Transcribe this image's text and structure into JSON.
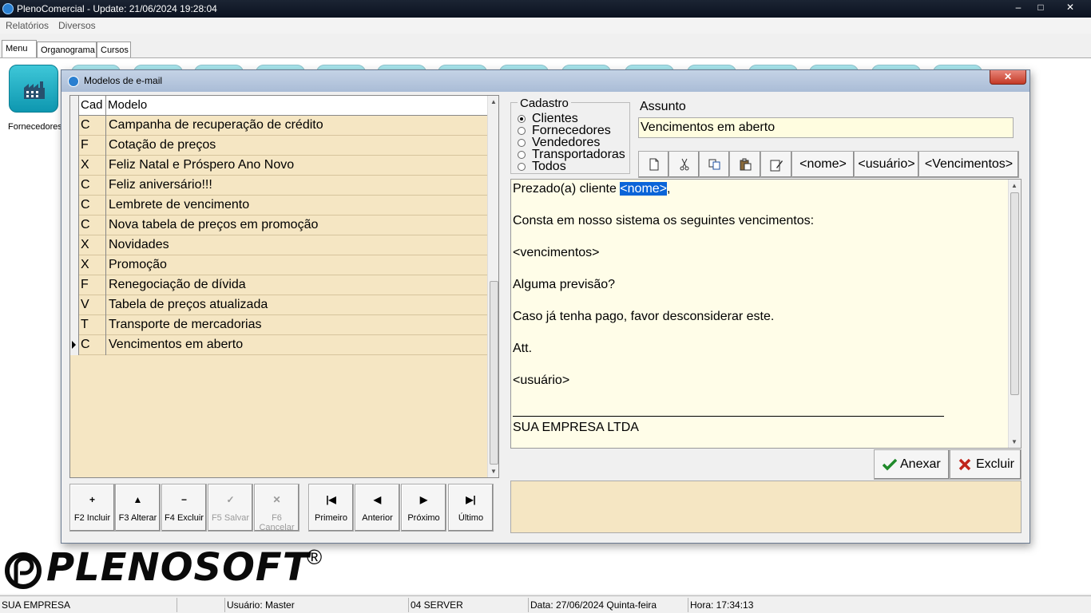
{
  "window": {
    "title": "PlenoComercial - Update: 21/06/2024 19:28:04",
    "minimize_icon": "minimize-icon",
    "maximize_icon": "maximize-icon",
    "close_icon": "close-icon"
  },
  "menu": {
    "items": [
      {
        "label": "Relatórios"
      },
      {
        "label": "Diversos"
      }
    ]
  },
  "tabs": [
    {
      "label": "Menu"
    },
    {
      "label": "Organograma"
    },
    {
      "label": "Cursos"
    }
  ],
  "desktop": {
    "fornecedores_label": "Fornecedores"
  },
  "dialog": {
    "title": "Modelos de e-mail",
    "close_label": "✕",
    "grid": {
      "col_cad": "Cad",
      "col_modelo": "Modelo",
      "rows": [
        {
          "cad": "C",
          "modelo": "Campanha de recuperação de crédito"
        },
        {
          "cad": "F",
          "modelo": "Cotação de preços"
        },
        {
          "cad": "X",
          "modelo": "Feliz Natal e Próspero Ano Novo"
        },
        {
          "cad": "C",
          "modelo": "Feliz aniversário!!!"
        },
        {
          "cad": "C",
          "modelo": "Lembrete de vencimento"
        },
        {
          "cad": "C",
          "modelo": "Nova tabela de preços em promoção"
        },
        {
          "cad": "X",
          "modelo": "Novidades"
        },
        {
          "cad": "X",
          "modelo": "Promoção"
        },
        {
          "cad": "F",
          "modelo": "Renegociação de dívida"
        },
        {
          "cad": "V",
          "modelo": "Tabela de preços atualizada"
        },
        {
          "cad": "T",
          "modelo": "Transporte de mercadorias"
        },
        {
          "cad": "C",
          "modelo": "Vencimentos em aberto"
        }
      ],
      "current_row": 11
    },
    "nav_buttons": [
      {
        "glyph": "+",
        "label": "F2 Incluir",
        "enabled": true
      },
      {
        "glyph": "▲",
        "label": "F3 Alterar",
        "enabled": true
      },
      {
        "glyph": "−",
        "label": "F4 Excluir",
        "enabled": true
      },
      {
        "glyph": "✓",
        "label": "F5 Salvar",
        "enabled": false
      },
      {
        "glyph": "✕",
        "label": "F6 Cancelar",
        "enabled": false
      },
      {
        "glyph": "|◀",
        "label": "Primeiro",
        "enabled": true
      },
      {
        "glyph": "◀",
        "label": "Anterior",
        "enabled": true
      },
      {
        "glyph": "▶",
        "label": "Próximo",
        "enabled": true
      },
      {
        "glyph": "▶|",
        "label": "Último",
        "enabled": true
      }
    ],
    "cadastro": {
      "legend": "Cadastro",
      "options": [
        "Clientes",
        "Fornecedores",
        "Vendedores",
        "Transportadoras",
        "Todos"
      ],
      "selected": 0
    },
    "assunto": {
      "label": "Assunto",
      "value": "Vencimentos em aberto"
    },
    "toolbar": {
      "icons": [
        "new-document-icon",
        "cut-icon",
        "copy-icon",
        "paste-icon",
        "edit-icon"
      ],
      "tag_nome": "<nome>",
      "tag_usuario": "<usuário>",
      "tag_vencimentos": "<Vencimentos>"
    },
    "body": {
      "line1_prefix": "Prezado(a) cliente ",
      "line1_tag": "<nome>",
      "line1_suffix": ",",
      "line2": "Consta em nosso sistema os seguintes vencimentos:",
      "line3": "<vencimentos>",
      "line4": "Alguma previsão?",
      "line5": "Caso já tenha pago, favor desconsiderar este.",
      "line6": "Att.",
      "line7": "<usuário>",
      "signature": "SUA EMPRESA LTDA"
    },
    "anexar_label": "Anexar",
    "excluir_label": "Excluir"
  },
  "logo": {
    "text": "PLENOSOFT",
    "reg": "®"
  },
  "status": {
    "empresa": "SUA EMPRESA",
    "usuario": "Usuário: Master",
    "server": "04 SERVER",
    "data": "Data: 27/06/2024 Quinta-feira",
    "hora": "Hora: 17:34:13"
  },
  "colors": {
    "grid_bg": "#f5e6c3",
    "editor_bg": "#fffde8",
    "accent_teal": "#0e97b0",
    "selection": "#0a64d8"
  }
}
